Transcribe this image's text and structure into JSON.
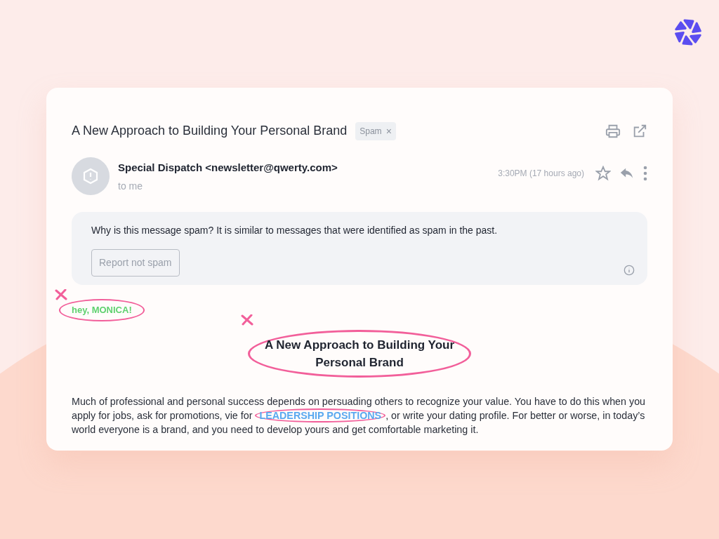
{
  "email": {
    "subject": "A New Approach to Building Your Personal Brand",
    "label": {
      "text": "Spam",
      "remove": "×"
    },
    "sender": "Special Dispatch <newsletter@qwerty.com>",
    "recipient": "to me",
    "time": "3:30PM (17 hours ago)",
    "starred": false
  },
  "spam_notice": {
    "text": "Why is this message spam? It is similar to messages that were identified as spam in the past.",
    "button": "Report not spam"
  },
  "body": {
    "greeting": "hey, MONICA!",
    "heading": "A New Approach to Building Your Personal Brand",
    "paragraph": "Much of professional and personal success depends on persuading others to recognize your value. You have to do this when you apply for jobs, ask for promotions, vie for **LEADERSHIP POSITIONS**, or write your dating profile. For better or worse, in today’s world everyone is a brand, and you need to develop yours and get comfortable marketing it."
  }
}
